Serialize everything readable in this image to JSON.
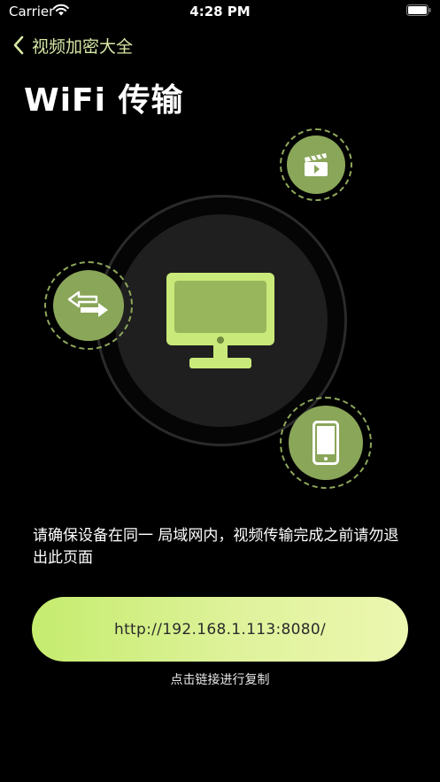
{
  "status_bar": {
    "carrier": "Carrier",
    "time": "4:28 PM",
    "wifi_icon": "wifi-icon",
    "battery_icon": "battery-icon"
  },
  "nav": {
    "back_icon": "chevron-left-icon",
    "title": "视频加密大全"
  },
  "page": {
    "title": "WiFi 传输"
  },
  "hero": {
    "center_icon": "monitor-icon",
    "bubbles": [
      {
        "icon": "video-clapper-icon"
      },
      {
        "icon": "transfer-arrows-icon"
      },
      {
        "icon": "phone-icon"
      }
    ]
  },
  "notice": "请确保设备在同一 局域网内，视频传输完成之前请勿退出此页面",
  "link": {
    "url": "http://192.168.1.113:8080/"
  },
  "hint": "点击链接进行复制",
  "colors": {
    "background": "#000000",
    "accent": "#c5ec6e",
    "bubble": "#8aa659",
    "nav_title": "#d6e8a5"
  }
}
